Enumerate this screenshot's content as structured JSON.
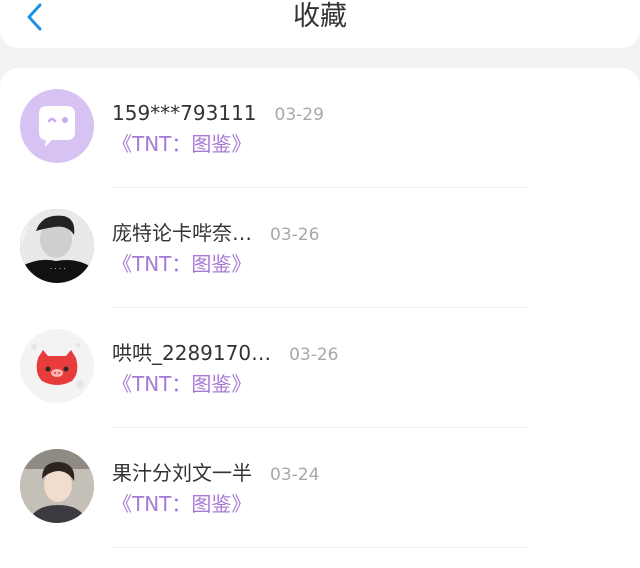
{
  "header": {
    "title": "收藏",
    "back_icon": "chevron-left-icon",
    "accent": "#1e90e8"
  },
  "favorites": [
    {
      "name": "159***793111",
      "date": "03-29",
      "tag": "《TNT：图鉴》",
      "avatar": "speech-bubble-avatar"
    },
    {
      "name": "庞特论卡哔奈…",
      "date": "03-26",
      "tag": "《TNT：图鉴》",
      "avatar": "photo-avatar"
    },
    {
      "name": "哄哄_2289170…",
      "date": "03-26",
      "tag": "《TNT：图鉴》",
      "avatar": "pig-avatar"
    },
    {
      "name": "果汁分刘文一半",
      "date": "03-24",
      "tag": "《TNT：图鉴》",
      "avatar": "photo-avatar"
    }
  ],
  "colors": {
    "tag": "#a67ad6",
    "date": "#a8a8a8",
    "text": "#333333"
  }
}
